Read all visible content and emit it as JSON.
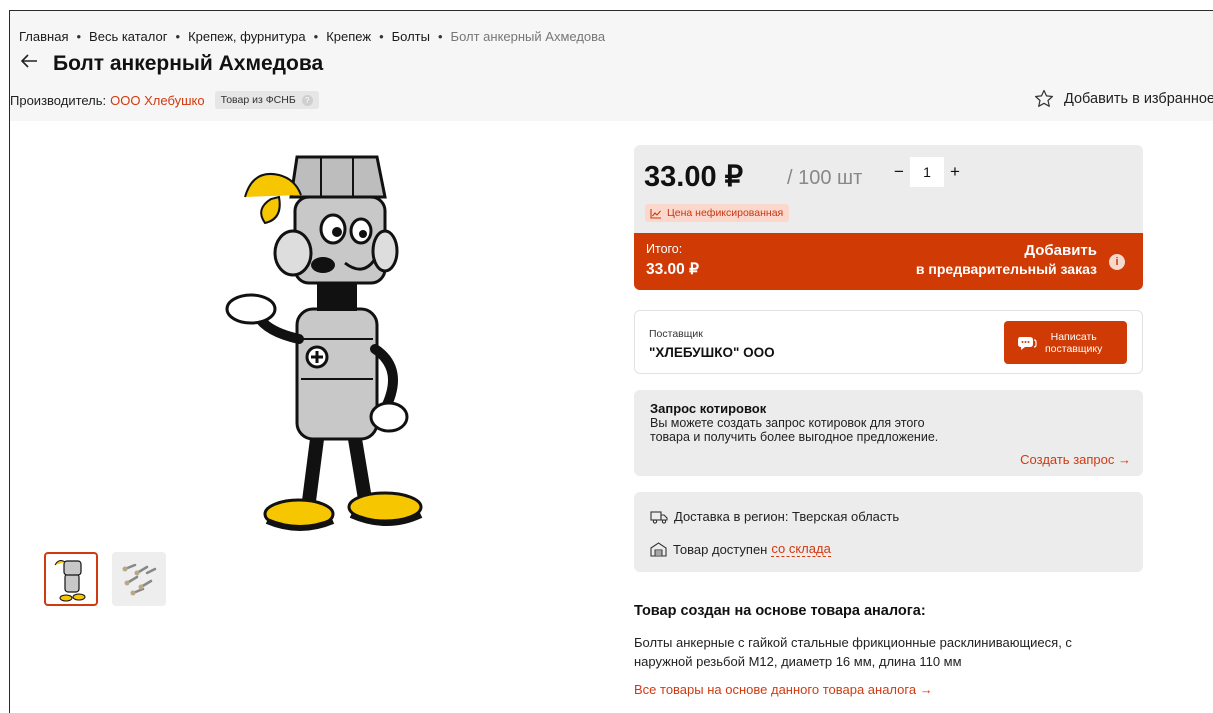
{
  "breadcrumb": {
    "items": [
      "Главная",
      "Весь каталог",
      "Крепеж, фурнитура",
      "Крепеж",
      "Болты"
    ],
    "current": "Болт анкерный Ахмедова",
    "separator": "•"
  },
  "product": {
    "title": "Болт анкерный Ахмедова",
    "maker_label": "Производитель:",
    "maker_name": "ООО Хлебушко",
    "fsnb_badge": "Товар из ФСНБ",
    "fsnb_help": "?",
    "favorite_label": "Добавить в избранное"
  },
  "price": {
    "value": "33.00 ₽",
    "unit": "/ 100 шт",
    "qty_minus": "−",
    "qty_value": "1",
    "qty_plus": "+",
    "note": "Цена нефиксированная",
    "total_label": "Итого:",
    "total_value": "33.00 ₽",
    "add_line1": "Добавить",
    "add_line2": "в предварительный заказ",
    "info": "i"
  },
  "supplier": {
    "label": "Поставщик",
    "name": "\"ХЛЕБУШКО\" ООО",
    "write_line1": "Написать",
    "write_line2": "поставщику"
  },
  "quote": {
    "title": "Запрос котировок",
    "text": "Вы можете создать запрос котировок для этого товара и получить более выгодное предложение.",
    "link": "Создать запрос →"
  },
  "delivery": {
    "region": "Доставка в регион: Тверская область",
    "stock_prefix": "Товар доступен",
    "stock_link": "со склада"
  },
  "analog": {
    "title": "Товар создан на основе товара аналога:",
    "text": "Болты анкерные с гайкой стальные фрикционные расклинивающиеся, с наружной резьбой М12, диаметр 16 мм, длина 110 мм",
    "link": "Все товары на основе данного товара аналога →"
  },
  "colors": {
    "accent": "#cf3a05",
    "link": "#d03a10",
    "card_bg": "#ececec",
    "note_bg": "#fbd7cc"
  },
  "icons": [
    "back-arrow-icon",
    "star-icon",
    "chart-icon",
    "info-icon",
    "chat-icon",
    "truck-icon",
    "warehouse-icon"
  ]
}
